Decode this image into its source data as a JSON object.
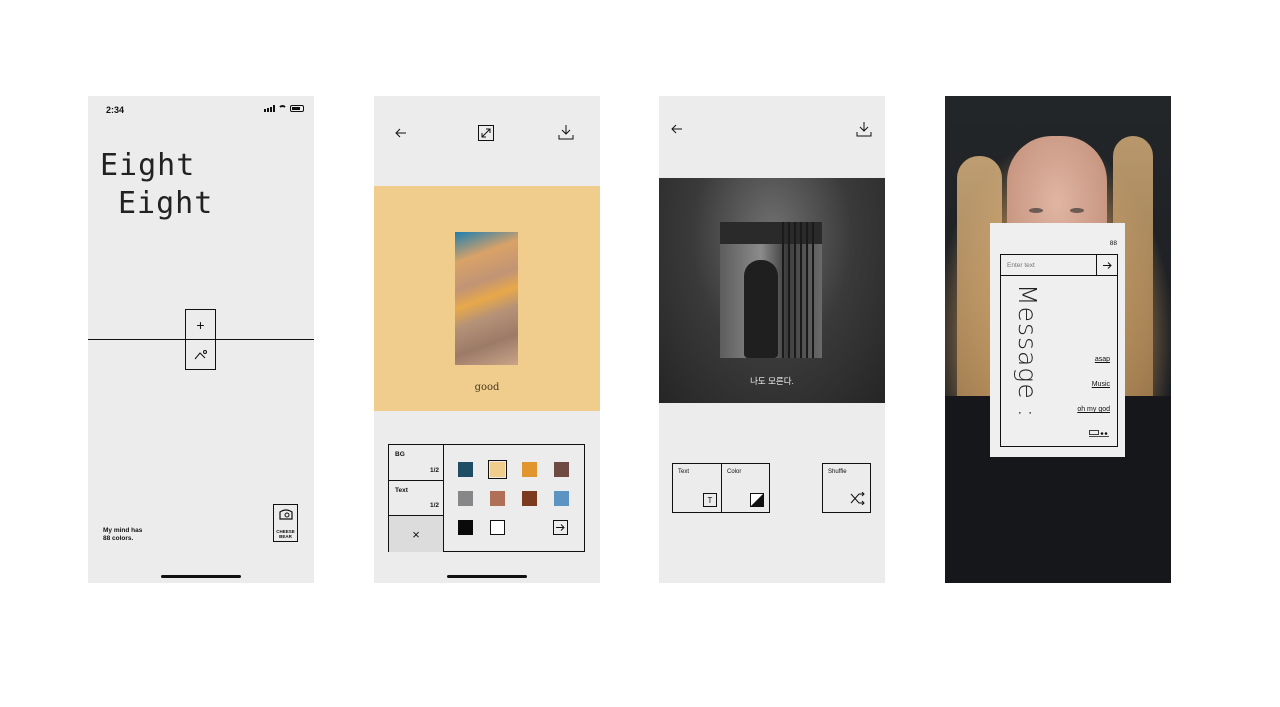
{
  "screen1": {
    "status_time": "2:34",
    "title_line1": "Eight",
    "title_line2": "Eight",
    "add_icon": "+",
    "tagline": "My mind has\n88 colors.",
    "logo_text_top": "CHEESE",
    "logo_text_bottom": "BEAR"
  },
  "screen2": {
    "caption": "good",
    "bg_label": "BG",
    "bg_page": "1/2",
    "text_label": "Text",
    "text_page": "1/2",
    "close_icon": "×",
    "swatches": [
      "#1d4e66",
      "#f0cd8d",
      "#e0952f",
      "#6e4a43",
      "#87878a",
      "#b07057",
      "#7c3a1e",
      "#5b93c2",
      "#0a0a0a",
      "#ffffff"
    ],
    "selected_swatch": "#f0cd8d"
  },
  "screen3": {
    "caption": "나도 모른다.",
    "text_label": "Text",
    "text_icon": "T",
    "color_label": "Color",
    "shuffle_label": "Shuffle"
  },
  "screen4": {
    "counter": "88",
    "input_placeholder": "Enter text",
    "vertical_message": "Message :",
    "links": [
      "asap",
      "Music",
      "oh my god"
    ]
  }
}
